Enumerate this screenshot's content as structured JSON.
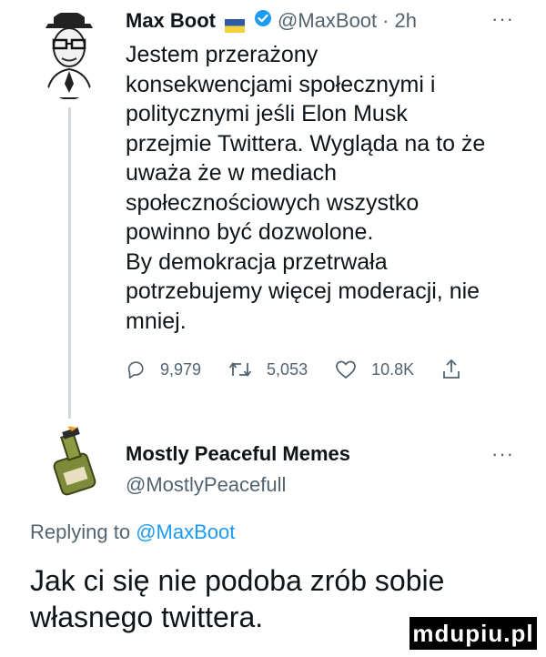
{
  "tweet": {
    "author_name": "Max Boot",
    "author_handle": "@MaxBoot",
    "separator": "·",
    "time": "2h",
    "more_label": "···",
    "text": "Jestem przerażony\nkonsekwencjami społecznymi i\npolitycznymi jeśli Elon Musk\nprzejmie Twittera. Wygląda na to że\nuważa że w mediach\nspołecznościowych wszystko\npowinno być dozwolone.\nBy demokracja przetrwała\npotrzebujemy więcej moderacji, nie\nmniej.",
    "replies": "9,979",
    "retweets": "5,053",
    "likes": "10.8K",
    "flag_colors": [
      "#2f5aa6",
      "#f5d23c"
    ],
    "verified_color": "#1d9bf0"
  },
  "reply": {
    "author_name": "Mostly Peaceful Memes",
    "author_handle": "@MostlyPeacefull",
    "more_label": "···",
    "replying_prefix": "Replying to",
    "replying_handle": "@MaxBoot",
    "text": "Jak ci się nie podoba zrób sobie własnego twittera."
  },
  "watermark": "mdupiu.pl",
  "colors": {
    "text": "#0f1419",
    "secondary": "#536471",
    "link": "#1d9bf0",
    "thread_line": "#cfd9de"
  }
}
